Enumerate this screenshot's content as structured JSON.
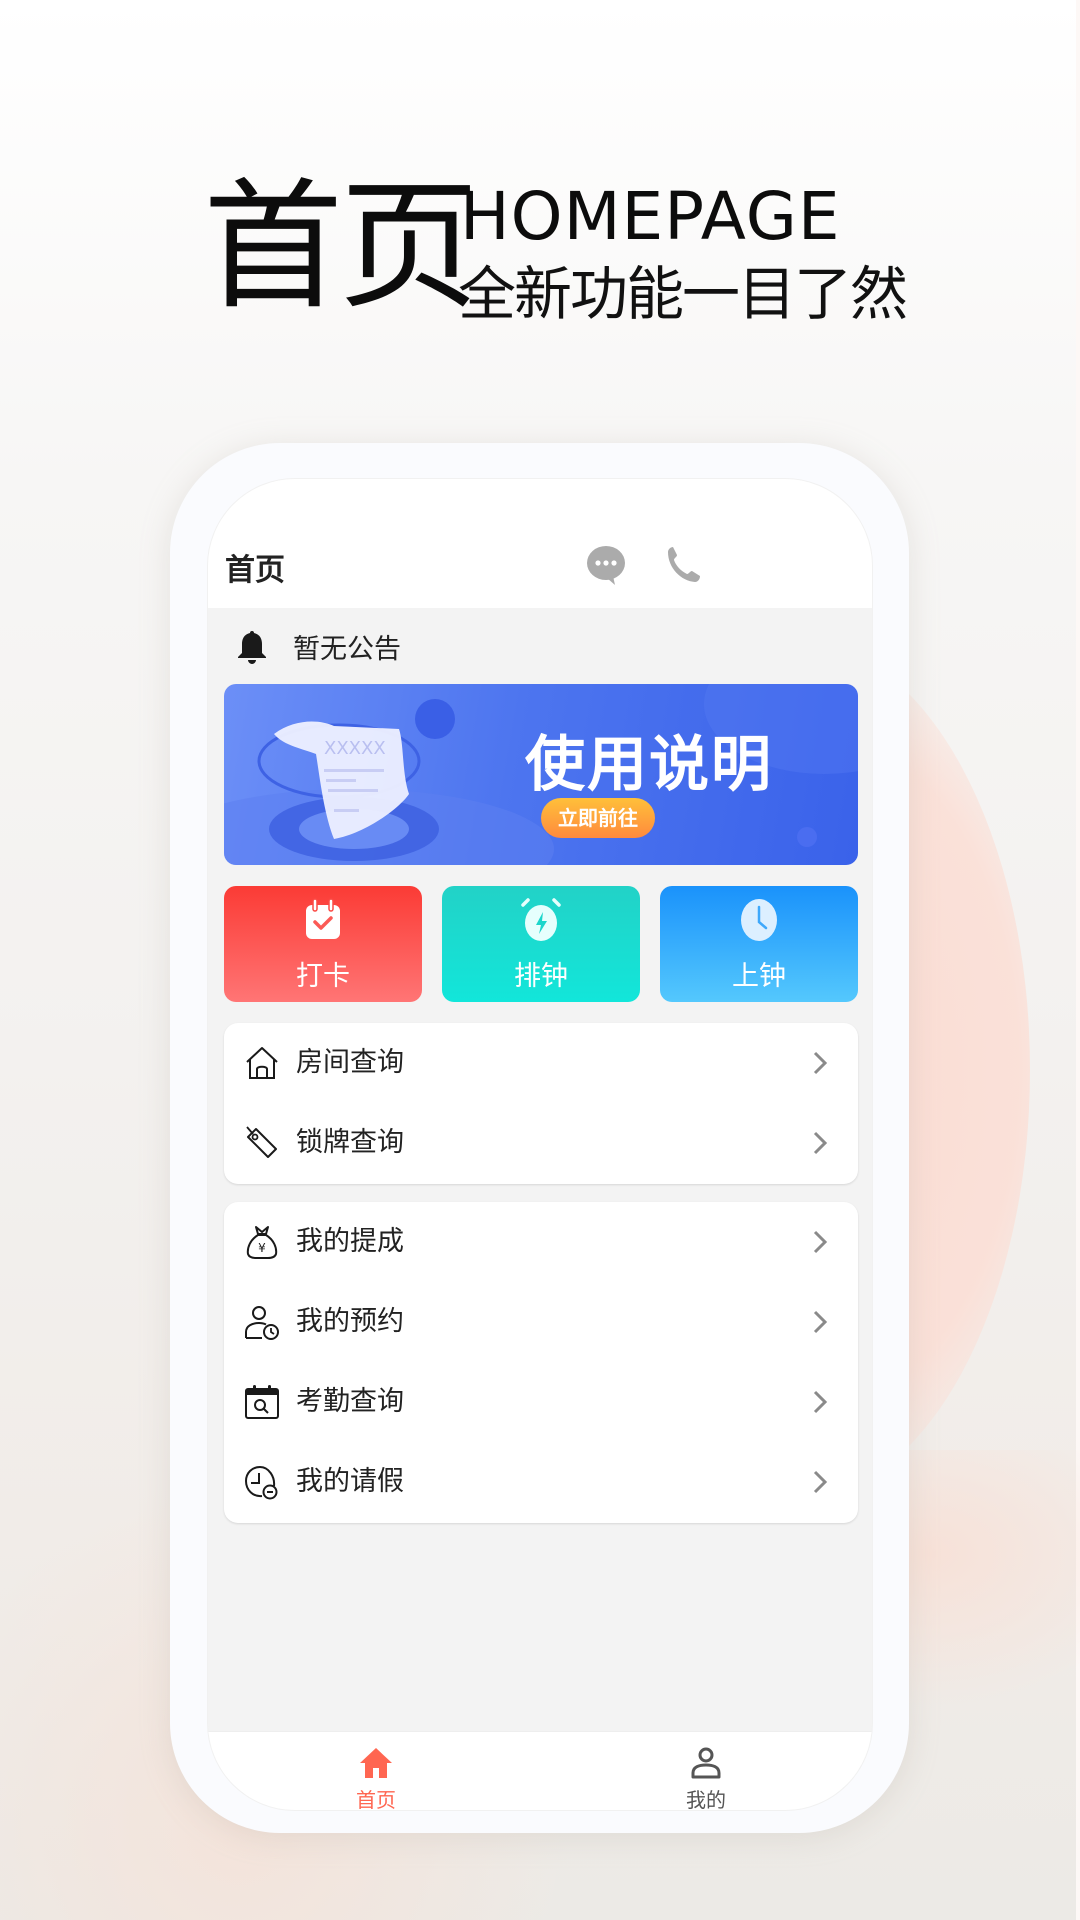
{
  "hero": {
    "title_cn": "首页",
    "title_en": "HOMEPAGE",
    "subtitle": "全新功能一目了然"
  },
  "app": {
    "header": {
      "title": "首页",
      "icons": [
        "chat-bubble-icon",
        "phone-icon"
      ]
    },
    "notice": {
      "icon": "bell-icon",
      "text": "暂无公告"
    },
    "banner": {
      "title": "使用说明",
      "button_label": "立即前往",
      "illustration_text": "XXXXX"
    },
    "quick_actions": [
      {
        "label": "打卡",
        "icon": "calendar-check-icon",
        "color": "#fb3b35"
      },
      {
        "label": "排钟",
        "icon": "alarm-clock-icon",
        "color": "#1edbd0"
      },
      {
        "label": "上钟",
        "icon": "clock-icon",
        "color": "#2aa6fc"
      }
    ],
    "menu_group_1": [
      {
        "label": "房间查询",
        "icon": "house-icon"
      },
      {
        "label": "锁牌查询",
        "icon": "tag-icon"
      }
    ],
    "menu_group_2": [
      {
        "label": "我的提成",
        "icon": "money-bag-icon"
      },
      {
        "label": "我的预约",
        "icon": "user-clock-icon"
      },
      {
        "label": "考勤查询",
        "icon": "calendar-search-icon"
      },
      {
        "label": "我的请假",
        "icon": "clock-minus-icon"
      }
    ],
    "tabbar": {
      "items": [
        {
          "label": "首页",
          "icon": "home-icon",
          "active": true
        },
        {
          "label": "我的",
          "icon": "user-icon",
          "active": false
        }
      ],
      "active_color": "#ff6651",
      "inactive_color": "#555555"
    }
  }
}
